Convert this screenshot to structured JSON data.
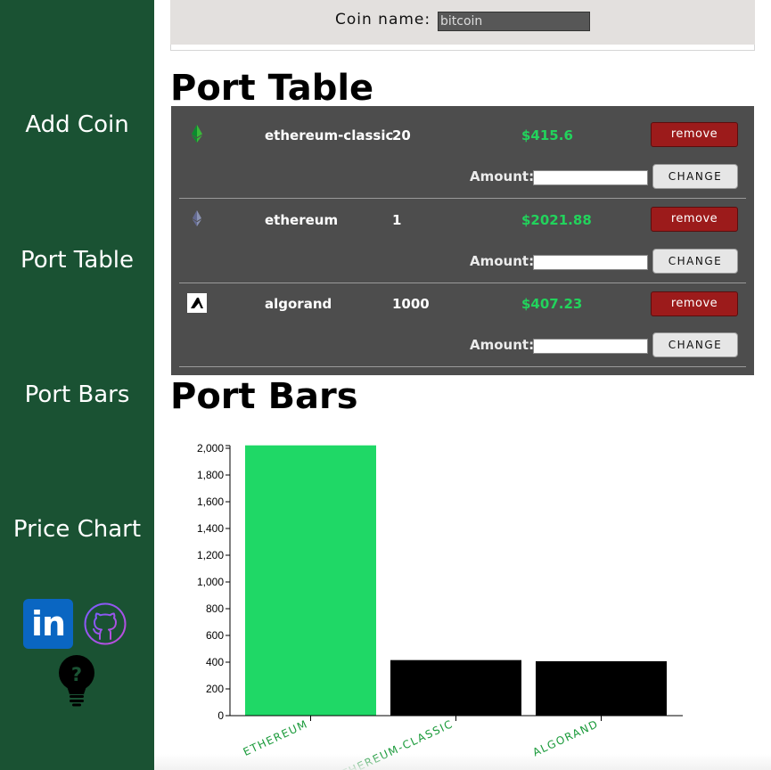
{
  "sidebar": {
    "items": [
      {
        "label": "Add Coin"
      },
      {
        "label": "Port Table"
      },
      {
        "label": "Port Bars"
      },
      {
        "label": "Price Chart"
      }
    ],
    "linkedin_text": "in",
    "icons": [
      "linkedin-icon",
      "github-icon",
      "help-bulb-icon"
    ]
  },
  "search": {
    "label": "Coin name:",
    "value": "bitcoin"
  },
  "sections": {
    "table_title": "Port Table",
    "bars_title": "Port Bars"
  },
  "table": {
    "amount_label": "Amount:",
    "remove_label": "remove",
    "change_label": "CHANGE",
    "rows": [
      {
        "name": "ethereum-classic",
        "amount": "20",
        "value": "$415.6",
        "icon": "ethereum-classic-icon"
      },
      {
        "name": "ethereum",
        "amount": "1",
        "value": "$2021.88",
        "icon": "ethereum-icon"
      },
      {
        "name": "algorand",
        "amount": "1000",
        "value": "$407.23",
        "icon": "algorand-icon"
      }
    ]
  },
  "colors": {
    "sidebar": "#1a5233",
    "highlight_bar": "#1fd866",
    "bar": "#000000",
    "value_text": "#22d35c",
    "remove_button": "#9c1b1b"
  },
  "chart_data": {
    "type": "bar",
    "categories": [
      "ETHEREUM",
      "ETHEREUM-CLASSIC",
      "ALGORAND"
    ],
    "values": [
      2021.88,
      415.6,
      407.23
    ],
    "ylim": [
      0,
      2000
    ],
    "yticks": [
      "0",
      "200",
      "400",
      "600",
      "800",
      "1,000",
      "1,200",
      "1,400",
      "1,600",
      "1,800",
      "2,000"
    ],
    "highlight_index": 0
  }
}
